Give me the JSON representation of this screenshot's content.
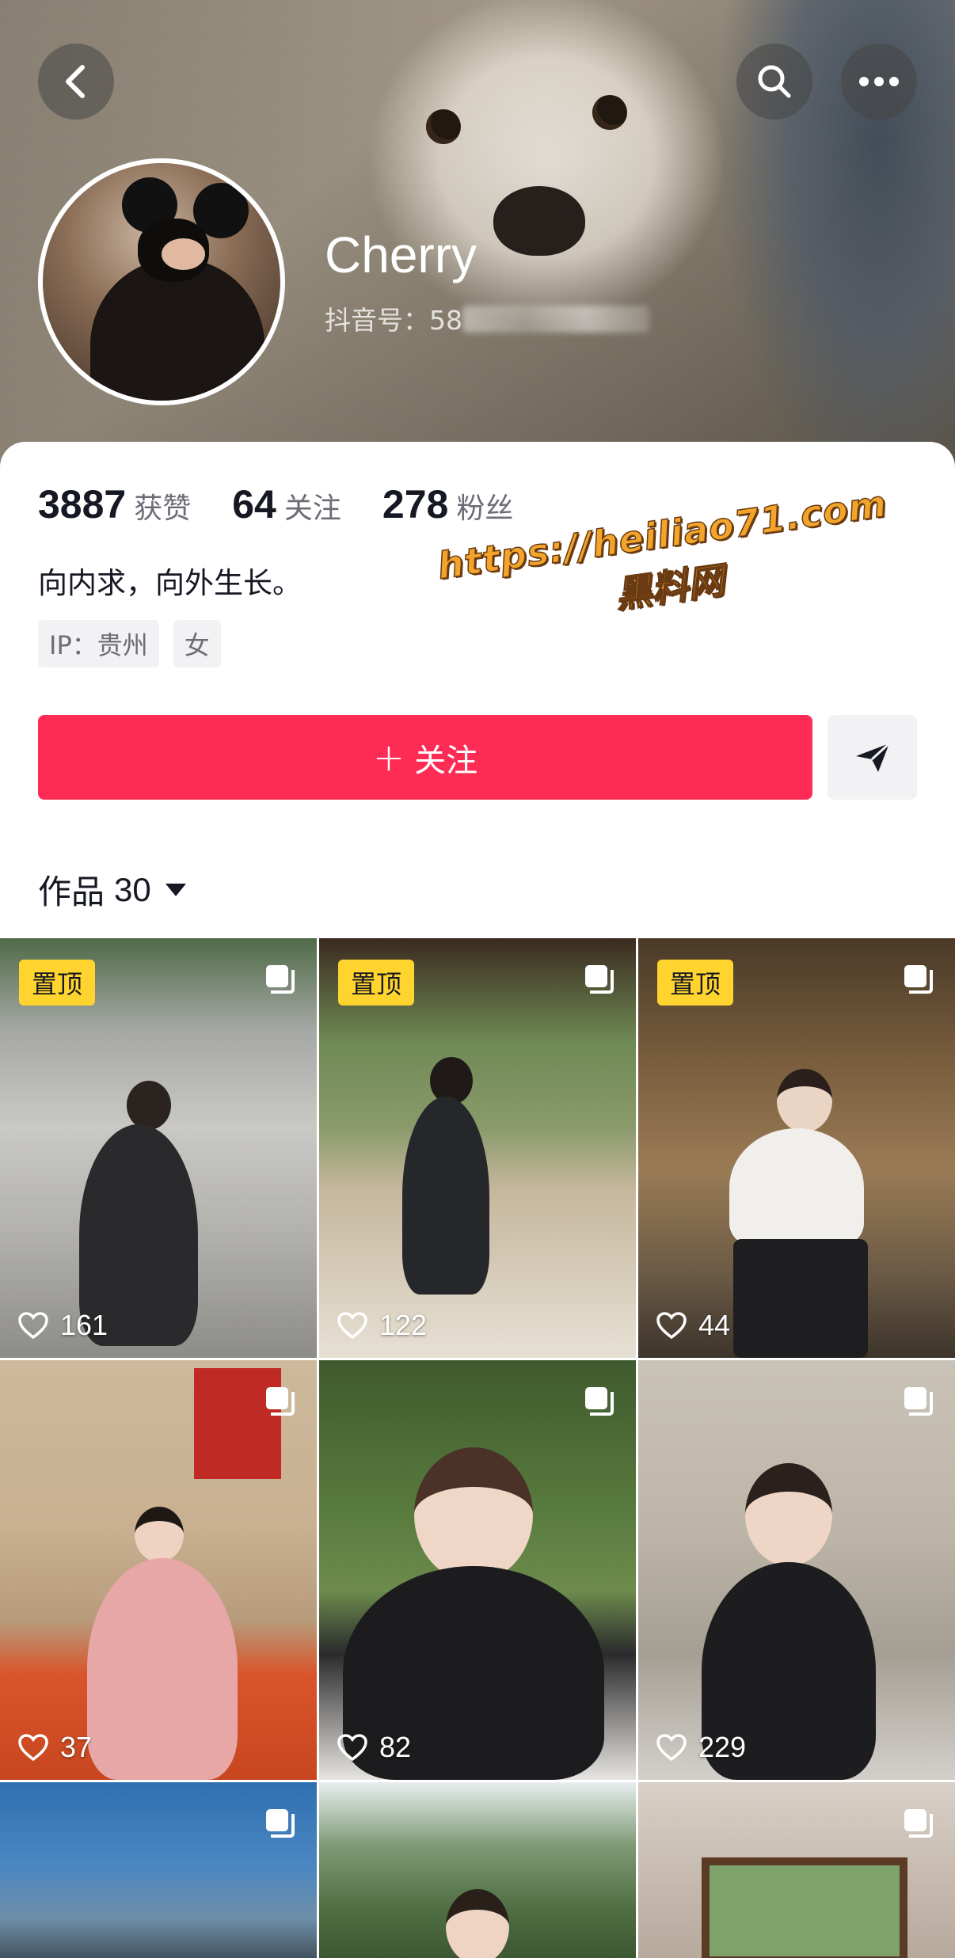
{
  "header": {
    "name": "Cherry",
    "douyin_id_label": "抖音号：58",
    "icons": {
      "back": "chevron-left-icon",
      "search": "search-icon",
      "more": "more-dots-icon"
    }
  },
  "stats": [
    {
      "value": "3887",
      "label": "获赞"
    },
    {
      "value": "64",
      "label": "关注"
    },
    {
      "value": "278",
      "label": "粉丝"
    }
  ],
  "bio": "向内求，向外生长。",
  "tags": [
    "IP：贵州",
    "女"
  ],
  "watermark": {
    "line1": "https://heiliao71.com",
    "line2": "黑料网"
  },
  "actions": {
    "follow_label": "关注",
    "follow_plus": "+"
  },
  "works": {
    "label": "作品",
    "count": "30"
  },
  "grid": {
    "pin_label": "置顶",
    "videos": [
      {
        "likes": "161",
        "pinned": true
      },
      {
        "likes": "122",
        "pinned": true
      },
      {
        "likes": "44",
        "pinned": true
      },
      {
        "likes": "37",
        "pinned": false
      },
      {
        "likes": "82",
        "pinned": false
      },
      {
        "likes": "229",
        "pinned": false
      },
      {
        "likes": "",
        "pinned": false
      },
      {
        "likes": "",
        "pinned": false
      },
      {
        "likes": "",
        "pinned": false
      }
    ]
  },
  "colors": {
    "accent": "#fe2c55",
    "pin_badge": "#ffd42e"
  }
}
